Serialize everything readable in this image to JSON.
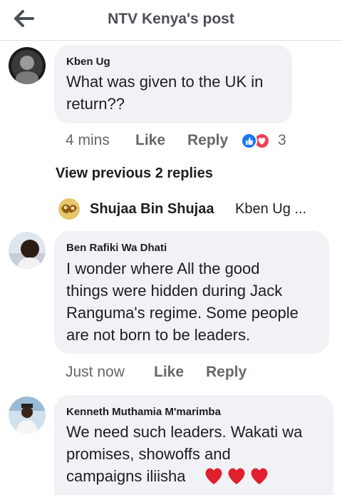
{
  "header": {
    "title": "NTV Kenya's post",
    "back_icon": "arrow-left-icon"
  },
  "comments": [
    {
      "author": "Kben Ug",
      "text_lines": [
        "What was given to the UK in",
        "return??"
      ],
      "time": "4 mins",
      "like_label": "Like",
      "reply_label": "Reply",
      "reaction_count": "3",
      "reactions": [
        "like-reaction-icon",
        "love-reaction-icon"
      ]
    },
    {
      "author": "Ben Rafiki Wa Dhati",
      "text_lines": [
        "I wonder where All the good",
        "things were hidden during Jack",
        "Ranguma's regime. Some people",
        "are not born to be leaders."
      ],
      "time": "Just now",
      "like_label": "Like",
      "reply_label": "Reply"
    },
    {
      "author": "Kenneth Muthamia M'marimba",
      "text_lines": [
        "We need such leaders. Wakati wa",
        "promises, showoffs and",
        "campaigns iliisha"
      ],
      "emoji": "heart-emoji-icon ×3"
    }
  ],
  "view_previous": "View previous 2 replies",
  "reply_preview": {
    "author": "Shujaa Bin Shujaa",
    "text": "Kben Ug ..."
  },
  "colors": {
    "bubble": "#f0f2f5",
    "meta": "#65676b",
    "like_blue": "#1877f2",
    "love_red": "#f33e58"
  }
}
